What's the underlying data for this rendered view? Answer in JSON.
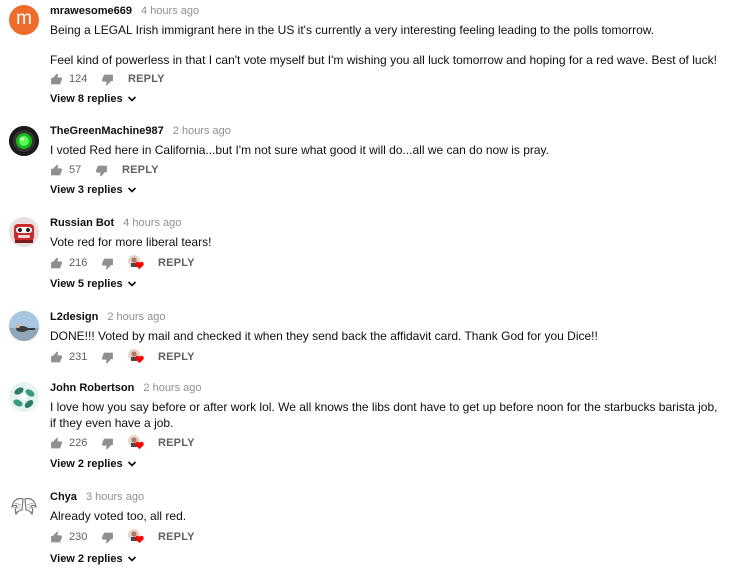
{
  "comments": [
    {
      "author": "mrawesome669",
      "time": "4 hours ago",
      "text": [
        "Being a LEGAL Irish immigrant here in the US it's currently a very interesting feeling leading to the polls tomorrow.",
        "Feel kind of powerless in that I can't vote myself but I'm wishing you all luck tomorrow and hoping for a red wave. Best of luck!"
      ],
      "likes": "124",
      "reply_label": "REPLY",
      "view_replies": "View 8 replies",
      "avatar": {
        "type": "letter",
        "letter": "m",
        "color": "#ef6c2c"
      }
    },
    {
      "author": "TheGreenMachine987",
      "time": "2 hours ago",
      "text": [
        "I voted Red here in California...but I'm not sure what good it will do...all we can do now is pray."
      ],
      "likes": "57",
      "reply_label": "REPLY",
      "view_replies": "View 3 replies",
      "avatar": {
        "type": "green-light-icon"
      }
    },
    {
      "author": "Russian Bot",
      "time": "4 hours ago",
      "text": [
        "Vote red for more liberal tears!"
      ],
      "likes": "216",
      "reply_label": "REPLY",
      "view_replies": "View 5 replies",
      "avatar": {
        "type": "robot-face-icon"
      }
    },
    {
      "author": "L2design",
      "time": "2 hours ago",
      "text": [
        "DONE!!! Voted by mail and checked it when they send back the affidavit card. Thank God for you Dice!!"
      ],
      "likes": "231",
      "reply_label": "REPLY",
      "avatar": {
        "type": "photo-person-icon"
      }
    },
    {
      "author": "John Robertson",
      "time": "2 hours ago",
      "text": [
        "I love how you say before or after work lol. We all knows the libs dont have to get up before noon for the starbucks barista job, if they even have a job."
      ],
      "likes": "226",
      "reply_label": "REPLY",
      "view_replies": "View 2 replies",
      "avatar": {
        "type": "leaf-pattern-icon"
      }
    },
    {
      "author": "Chya",
      "time": "3 hours ago",
      "text": [
        "Already voted too, all red."
      ],
      "likes": "230",
      "reply_label": "REPLY",
      "view_replies": "View 2 replies",
      "avatar": {
        "type": "wings-icon"
      }
    }
  ],
  "colors": {
    "heart": "#ff0000",
    "meta": "#909090",
    "action": "#606060"
  }
}
